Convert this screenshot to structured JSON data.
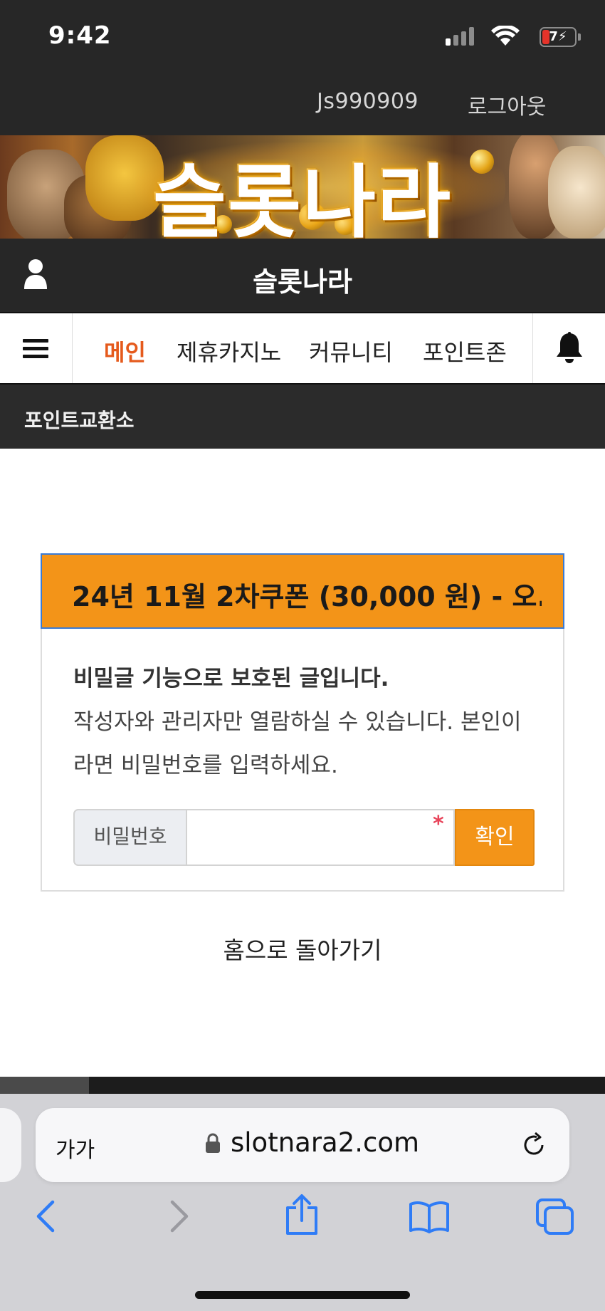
{
  "status_bar": {
    "time": "9:42",
    "battery": "7"
  },
  "account": {
    "username": "Js990909",
    "logout_label": "로그아웃"
  },
  "banner": {
    "logo_text": "슬롯나라"
  },
  "site": {
    "title": "슬롯나라"
  },
  "nav": {
    "items": [
      {
        "label": "메인",
        "active": true
      },
      {
        "label": "제휴카지노",
        "active": false
      },
      {
        "label": "커뮤니티",
        "active": false
      },
      {
        "label": "포인트존",
        "active": false
      }
    ]
  },
  "subheader": {
    "title": "포인트교환소"
  },
  "post": {
    "title": "24년 11월 2차쿠폰 (30,000 원) - 오...",
    "protected_heading": "비밀글 기능으로 보호된 글입니다.",
    "protected_body": "작성자와 관리자만 열람하실 수 있습니다. 본인이라면 비밀번호를 입력하세요.",
    "password_label": "비밀번호",
    "password_value": "",
    "required_mark": "*",
    "confirm_label": "확인"
  },
  "home_link": "홈으로 돌아가기",
  "browser": {
    "text_size_label": "가가",
    "url": "slotnara2.com"
  },
  "colors": {
    "accent_orange": "#f39418",
    "nav_active": "#e55a1c",
    "dark_bar": "#272727"
  },
  "icons": [
    "user-icon",
    "hamburger-menu-icon",
    "bell-icon",
    "lock-icon",
    "reload-icon",
    "back-icon",
    "forward-icon",
    "share-icon",
    "bookmarks-icon",
    "tabs-icon"
  ]
}
